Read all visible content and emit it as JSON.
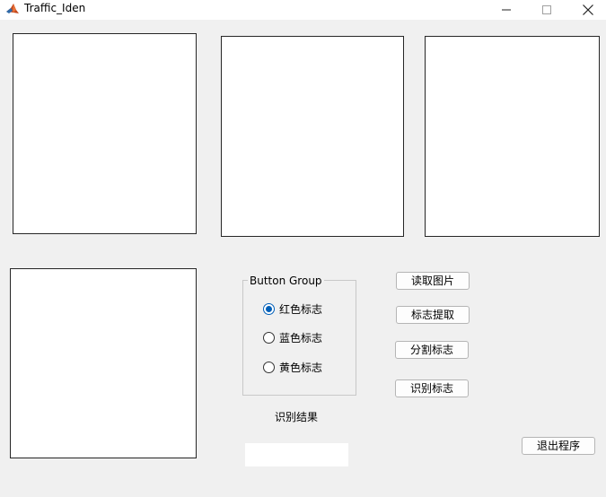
{
  "window": {
    "title": "Traffic_Iden",
    "controls": {
      "minimize": "—",
      "maximize": "☐",
      "close": "✕"
    }
  },
  "axes": [
    "axes1",
    "axes2",
    "axes3",
    "axes4"
  ],
  "button_group": {
    "title": "Button Group",
    "options": [
      {
        "label": "红色标志",
        "checked": true
      },
      {
        "label": "蓝色标志",
        "checked": false
      },
      {
        "label": "黄色标志",
        "checked": false
      }
    ]
  },
  "buttons": {
    "read_image": "读取图片",
    "extract_sign": "标志提取",
    "segment_sign": "分割标志",
    "recognize_sign": "识别标志",
    "exit": "退出程序"
  },
  "result": {
    "label": "识别结果",
    "value": ""
  },
  "colors": {
    "accent": "#005fb8",
    "background": "#f0f0f0",
    "panel": "#ffffff"
  }
}
